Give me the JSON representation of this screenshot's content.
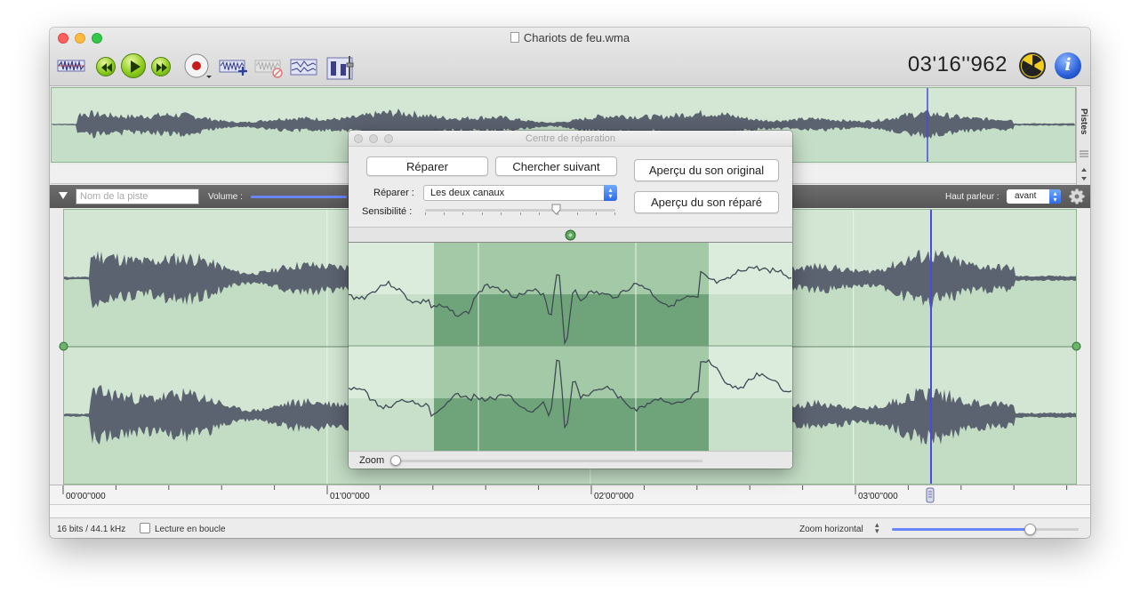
{
  "window": {
    "title": "Chariots de feu.wma",
    "time_readout": "03'16''962",
    "info_label": "i"
  },
  "toolbar": {
    "buttons": [
      "waveform-icon",
      "rewind-icon",
      "play-icon",
      "fast-forward-icon",
      "record-icon",
      "add-track-icon",
      "delete-track-icon",
      "repair-icon",
      "mixer-icon",
      "nuke-icon",
      "info-icon"
    ]
  },
  "overview": {
    "side_label": "Pistes"
  },
  "track": {
    "name_placeholder": "Nom de la piste",
    "volume_label": "Volume :",
    "speaker_label": "Haut parleur :",
    "speaker_value": "avant",
    "playhead_time": "03'16''962"
  },
  "ruler": {
    "labels": [
      "00'00''000",
      "01'00''000",
      "02'00''000",
      "03'00''000"
    ]
  },
  "status": {
    "format": "16 bits / 44.1 kHz",
    "loop_label": "Lecture en boucle",
    "loop_checked": false,
    "hzoom_label": "Zoom horizontal",
    "hzoom_level": 0.74
  },
  "repair_dialog": {
    "title": "Centre de réparation",
    "repair_button": "Réparer",
    "find_next_button": "Chercher suivant",
    "preview_original_button": "Aperçu du son original",
    "preview_repaired_button": "Aperçu du son réparé",
    "repair_label": "Réparer :",
    "channel_value": "Les deux canaux",
    "sensitivity_label": "Sensibilité :",
    "sensitivity_level": 0.69,
    "zoom_label": "Zoom",
    "zoom_level": 0.0
  },
  "colors": {
    "wave_fill": "#5b6270",
    "wave_bg": "#d2e6d3",
    "playhead": "#4a4ae0",
    "selection_dark": "#6fa47a",
    "accent": "#6a86ff"
  }
}
